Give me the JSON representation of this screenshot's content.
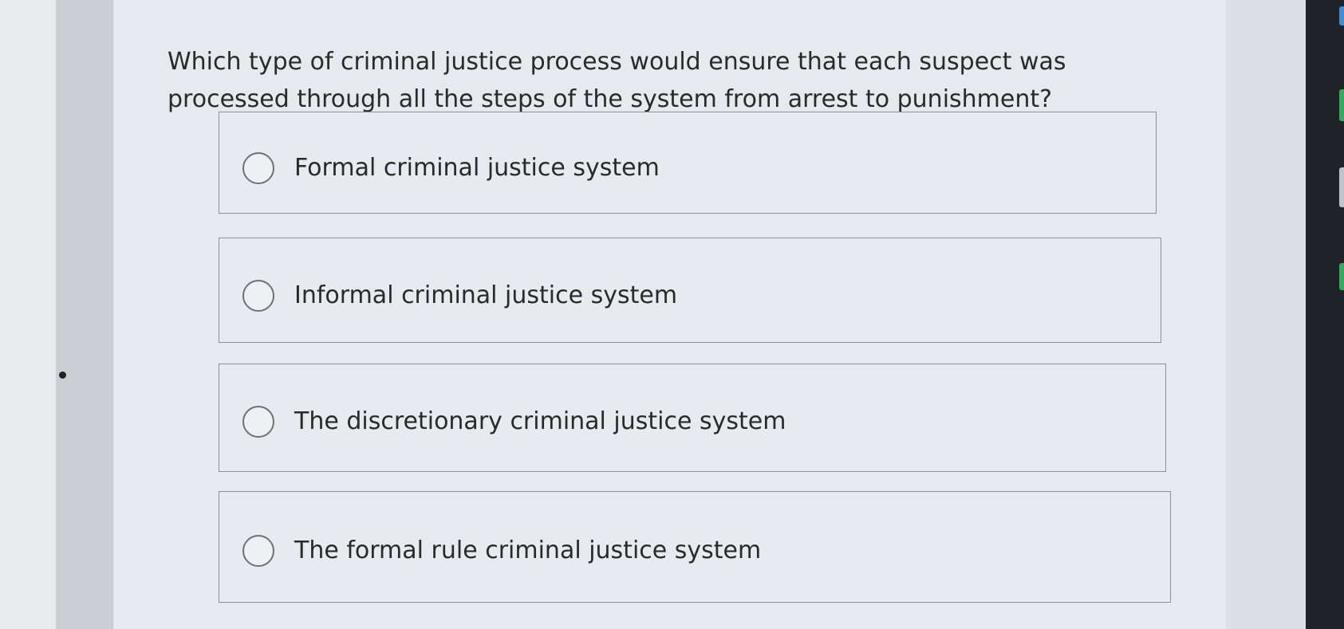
{
  "question": {
    "text": "Which type of criminal justice process would ensure that each suspect was processed through all the steps of the system from arrest to punishment?"
  },
  "options": [
    {
      "label": "Formal criminal justice system",
      "selected": false
    },
    {
      "label": "Informal criminal justice system",
      "selected": false
    },
    {
      "label": "The discretionary criminal justice system",
      "selected": false
    },
    {
      "label": "The formal rule criminal justice system",
      "selected": false
    }
  ],
  "colors": {
    "page_background": "#e6e9ed",
    "option_border": "#8d9196",
    "radio_border": "#6e7277",
    "text": "#2a2a2a",
    "edge_blue": "#3a8fd8",
    "edge_green": "#2fae5c"
  }
}
